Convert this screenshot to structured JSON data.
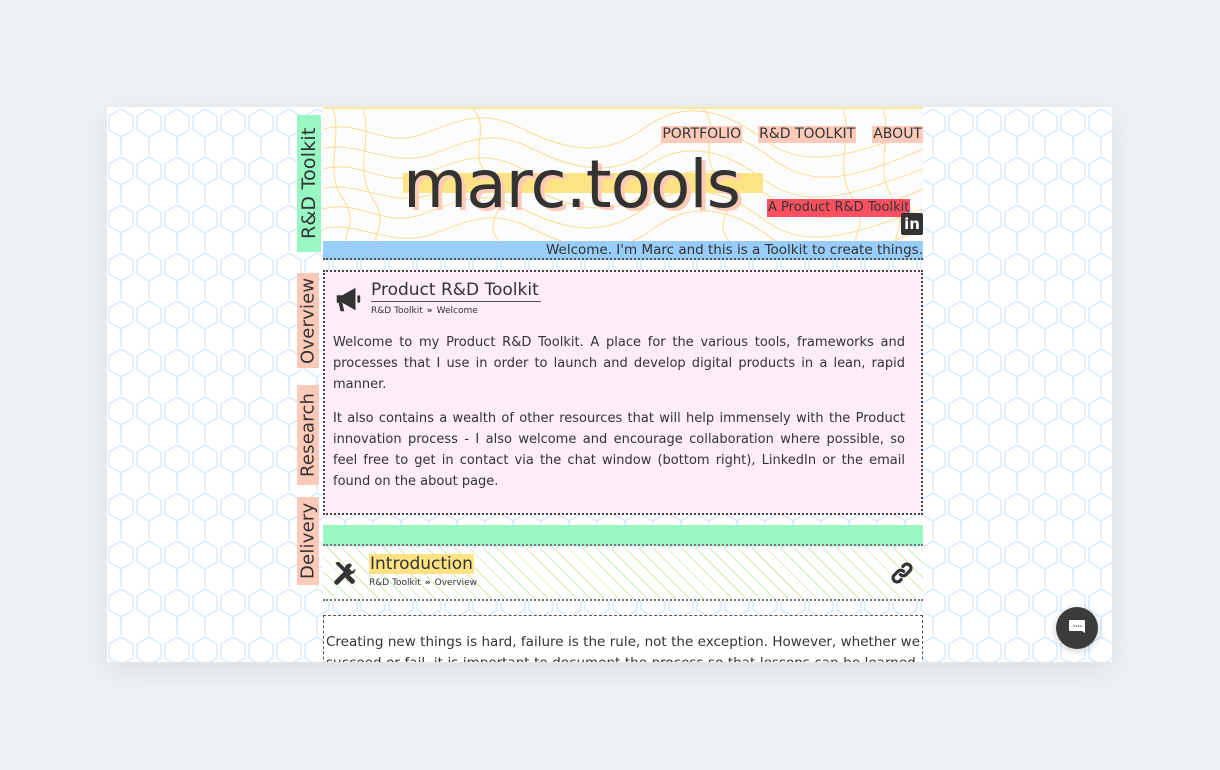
{
  "sidenav": {
    "brand": "R&D Toolkit",
    "items": [
      {
        "label": "Overview"
      },
      {
        "label": "Research"
      },
      {
        "label": "Delivery"
      }
    ]
  },
  "header": {
    "nav": [
      "PORTFOLIO",
      "R&D TOOLKIT",
      "ABOUT"
    ],
    "logo": "marc.tools",
    "tagline": "A Product R&D Toolkit",
    "linkedin_icon": "linkedin-icon",
    "welcome": "Welcome. I'm Marc and this is a Toolkit to create things."
  },
  "card": {
    "icon": "megaphone-icon",
    "title": "Product R&D Toolkit",
    "breadcrumb": [
      "R&D Toolkit",
      "Welcome"
    ],
    "paragraphs": [
      "Welcome to my Product R&D Toolkit. A place for the various tools, frameworks and processes that I use in order to launch and develop digital products in a lean, rapid manner.",
      "It also contains a wealth of other resources that will help immensely with the Product innovation process - I also welcome and encourage collaboration where possible, so feel free to get in contact via the chat window (bottom right), LinkedIn or the email found on the about page."
    ]
  },
  "intro": {
    "icon": "tools-icon",
    "title": "Introduction",
    "breadcrumb": [
      "R&D Toolkit",
      "Overview"
    ],
    "link_icon": "link-icon"
  },
  "textbox": {
    "text": "Creating new things is hard, failure is the rule, not the exception. However, whether we succeed or fail, it is important to document the process so that lessons can be learned, mistakes can be"
  },
  "chat": {
    "icon": "chat-icon"
  },
  "colors": {
    "mint": "#98f7c3",
    "peach": "#fdc9b8",
    "yellow": "#fde384",
    "red": "#fb5060",
    "blue": "#98ccf9",
    "pink": "#fcedf8"
  }
}
